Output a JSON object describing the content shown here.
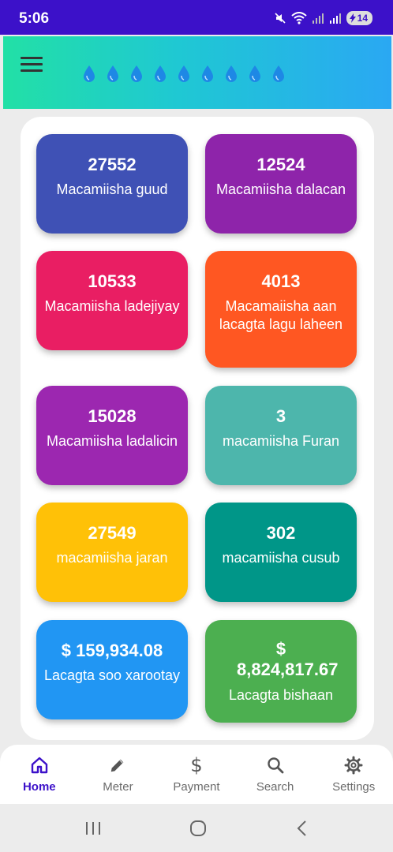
{
  "status_bar": {
    "time": "5:06",
    "battery": "14"
  },
  "app_bar": {
    "drop_count": 9
  },
  "tiles": [
    {
      "value": "27552",
      "label": "Macamiisha guud",
      "color": "#3f51b5"
    },
    {
      "value": "12524",
      "label": "Macamiisha dalacan",
      "color": "#8e24aa"
    },
    {
      "value": "10533",
      "label": "Macamiisha ladejiyay",
      "color": "#e91e63"
    },
    {
      "value": "4013",
      "label": "Macamaiisha aan lacagta lagu laheen",
      "color": "#ff5722"
    },
    {
      "value": "15028",
      "label": "Macamiisha ladalicin",
      "color": "#9c27b0"
    },
    {
      "value": "3",
      "label": "macamiisha Furan",
      "color": "#4db6ac"
    },
    {
      "value": "27549",
      "label": "macamiisha jaran",
      "color": "#ffc107"
    },
    {
      "value": "302",
      "label": "macamiisha cusub",
      "color": "#009688"
    },
    {
      "value": "$ 159,934.08",
      "label": "Lacagta soo xarootay",
      "color": "#2196f3"
    },
    {
      "value": "$ 8,824,817.67",
      "label": "Lacagta bishaan",
      "color": "#4caf50"
    }
  ],
  "bottom_nav": [
    {
      "label": "Home",
      "icon": "home-icon",
      "active": true
    },
    {
      "label": "Meter",
      "icon": "pencil-icon",
      "active": false
    },
    {
      "label": "Payment",
      "icon": "dollar-icon",
      "active": false
    },
    {
      "label": "Search",
      "icon": "search-icon",
      "active": false
    },
    {
      "label": "Settings",
      "icon": "gear-icon",
      "active": false
    }
  ],
  "colors": {
    "status_bar": "#3c11c9",
    "active_nav": "#3c11c9"
  }
}
